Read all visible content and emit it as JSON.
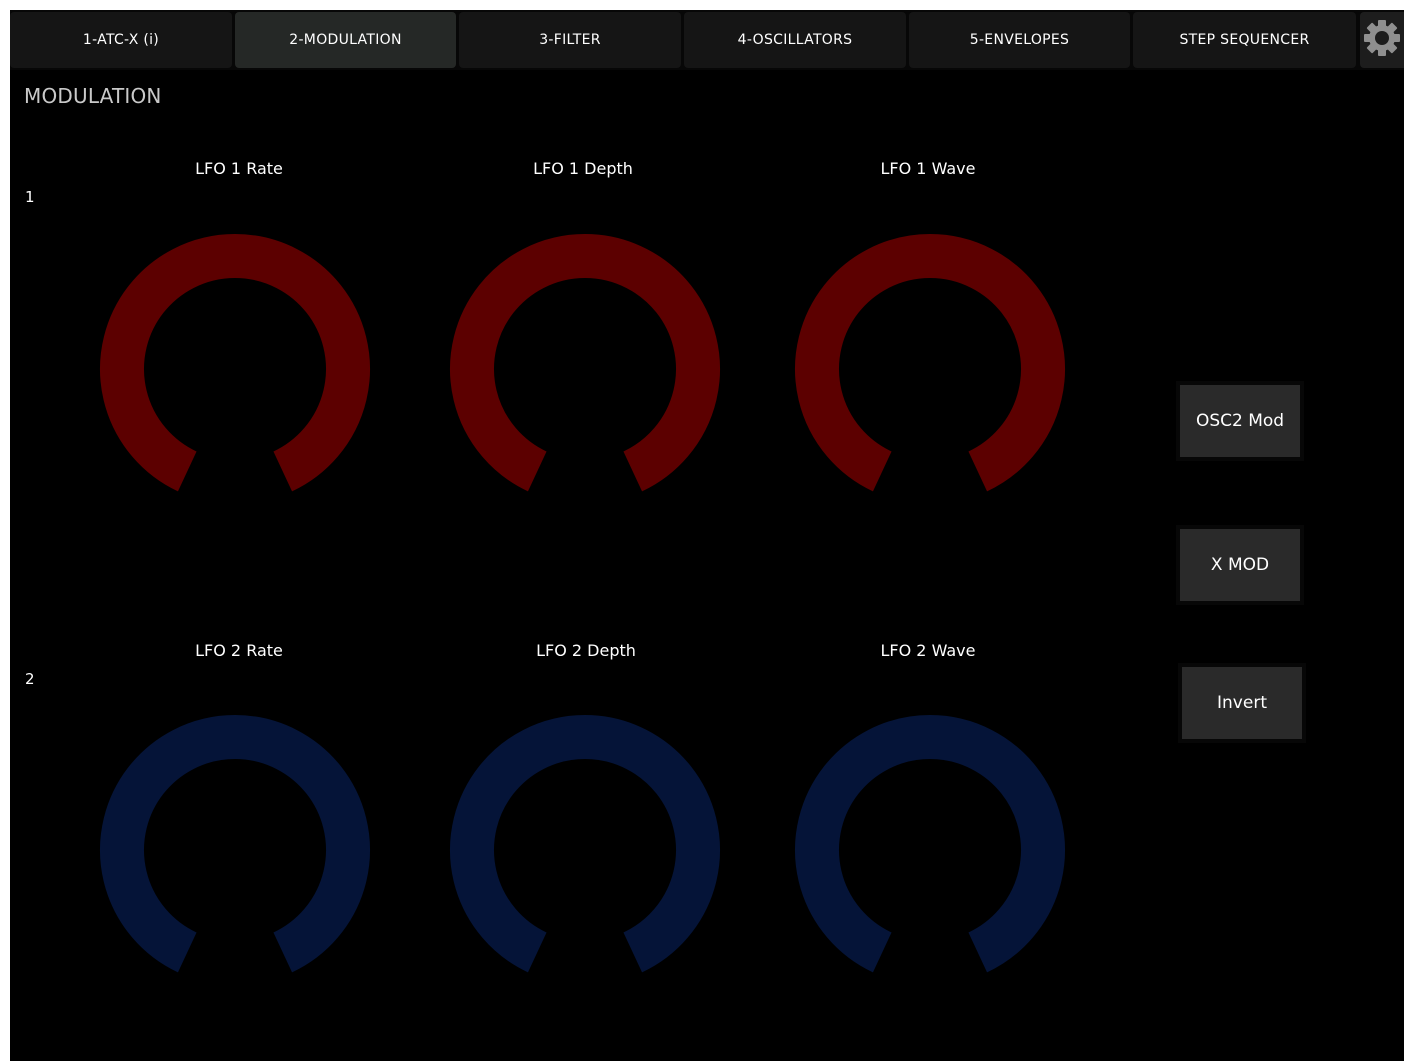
{
  "tabs": [
    {
      "label": "1-ATC-X (i)",
      "active": false
    },
    {
      "label": "2-MODULATION",
      "active": true
    },
    {
      "label": "3-FILTER",
      "active": false
    },
    {
      "label": "4-OSCILLATORS",
      "active": false
    },
    {
      "label": "5-ENVELOPES",
      "active": false
    },
    {
      "label": "STEP SEQUENCER",
      "active": false
    }
  ],
  "settings_icon": "gear-icon",
  "page_title": "MODULATION",
  "rows": [
    {
      "number": "1",
      "color": "#5c0000",
      "knobs": [
        {
          "label": "LFO 1 Rate"
        },
        {
          "label": "LFO 1 Depth"
        },
        {
          "label": "LFO 1 Wave"
        }
      ]
    },
    {
      "number": "2",
      "color": "#051438",
      "knobs": [
        {
          "label": "LFO 2 Rate"
        },
        {
          "label": "LFO 2 Depth"
        },
        {
          "label": "LFO 2 Wave"
        }
      ]
    }
  ],
  "side_buttons": [
    {
      "label": "OSC2 Mod"
    },
    {
      "label": "X MOD"
    },
    {
      "label": "Invert"
    }
  ],
  "colors": {
    "background": "#000000",
    "tab_bg": "#151515",
    "tab_active_bg": "#252826",
    "button_bg": "#2a2a2a",
    "lfo1_ring": "#5c0000",
    "lfo2_ring": "#051438"
  }
}
